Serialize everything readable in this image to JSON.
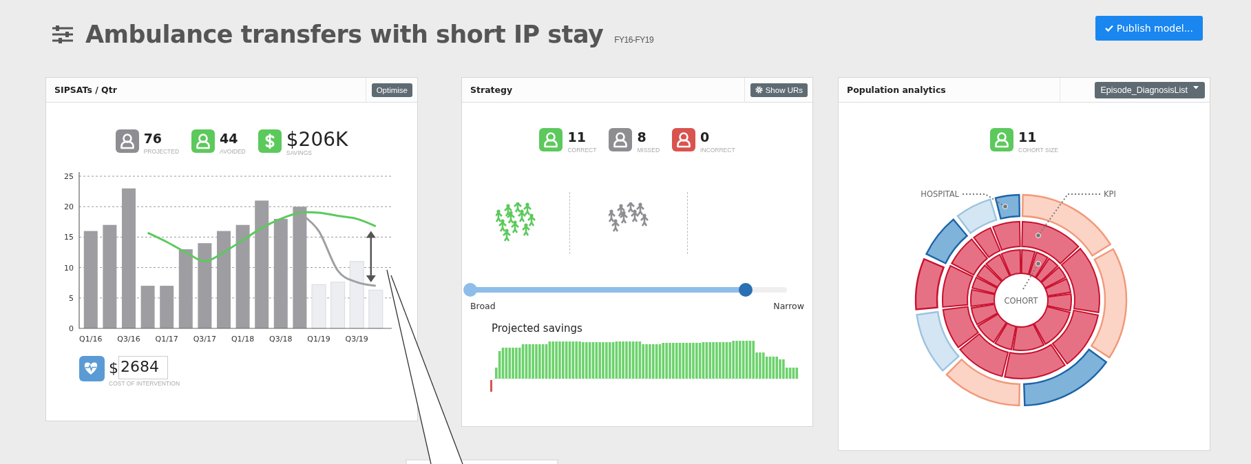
{
  "header": {
    "title": "Ambulance transfers with short IP stay",
    "period": "FY16-FY19",
    "publish_button": "Publish model..."
  },
  "panels": [
    {
      "kind": "chart",
      "title": "SIPSATs / Qtr",
      "action_button": "Optimise",
      "stats": [
        {
          "kind": "person",
          "color": "#8e8d92",
          "value": "76",
          "label": "PROJECTED"
        },
        {
          "kind": "person",
          "color": "#5cc95c",
          "value": "44",
          "label": "AVOIDED"
        },
        {
          "kind": "money",
          "color": "#5cc95c",
          "value": "$206K",
          "label": "SAVINGS"
        }
      ],
      "chart_data": {
        "type": "bar",
        "categories": [
          "Q1/16",
          null,
          "Q3/16",
          null,
          "Q1/17",
          null,
          "Q3/17",
          null,
          "Q1/18",
          null,
          "Q3/18",
          null,
          "Q1/19",
          null,
          "Q3/19",
          null
        ],
        "yticks": [
          0,
          5,
          10,
          15,
          20,
          25
        ],
        "ylim": [
          0,
          25
        ],
        "grid": true,
        "series": [
          {
            "color": "#9e9da2",
            "values": [
              16,
              17,
              23,
              7,
              7,
              13,
              14,
              16,
              17,
              21,
              18,
              20,
              null,
              null,
              null,
              null
            ]
          },
          {
            "color": "#eceef1",
            "values": [
              null,
              null,
              null,
              null,
              null,
              null,
              null,
              null,
              null,
              null,
              null,
              null,
              7.2,
              7.6,
              11,
              6.3
            ]
          },
          {
            "type": "line",
            "color": "#5cc95c",
            "values": [
              null,
              null,
              null,
              15.7,
              14.2,
              12.5,
              11,
              12.5,
              14.5,
              16.5,
              18,
              19,
              19,
              18.5,
              18,
              16.8
            ]
          },
          {
            "type": "line",
            "color": "#a09fa3",
            "values": [
              null,
              null,
              null,
              null,
              null,
              null,
              null,
              null,
              null,
              null,
              null,
              19,
              16,
              9.5,
              7.6,
              7
            ]
          }
        ]
      },
      "cost": {
        "currency": "$",
        "value": "2684",
        "label": "COST OF INTERVENTION"
      }
    },
    {
      "kind": "strategy",
      "title": "Strategy",
      "action_button": "Show URs",
      "stats": [
        {
          "kind": "person",
          "color": "#5cc95c",
          "value": "11",
          "label": "CORRECT"
        },
        {
          "kind": "person",
          "color": "#8e8d92",
          "value": "8",
          "label": "MISSED"
        },
        {
          "kind": "person",
          "color": "#d9534f",
          "value": "0",
          "label": "INCORRECT"
        }
      ],
      "slider": {
        "min_label": "Broad",
        "max_label": "Narrow",
        "level": 0.87
      },
      "savings_title": "Projected savings"
    },
    {
      "kind": "population",
      "title": "Population analytics",
      "dropdown": "Episode_DiagnosisList",
      "stats": [
        {
          "kind": "person",
          "color": "#5cc95c",
          "value": "11",
          "label": "COHORT SIZE"
        }
      ],
      "sunburst_labels": [
        "HOSPITAL",
        "KPI",
        "COHORT"
      ]
    }
  ]
}
